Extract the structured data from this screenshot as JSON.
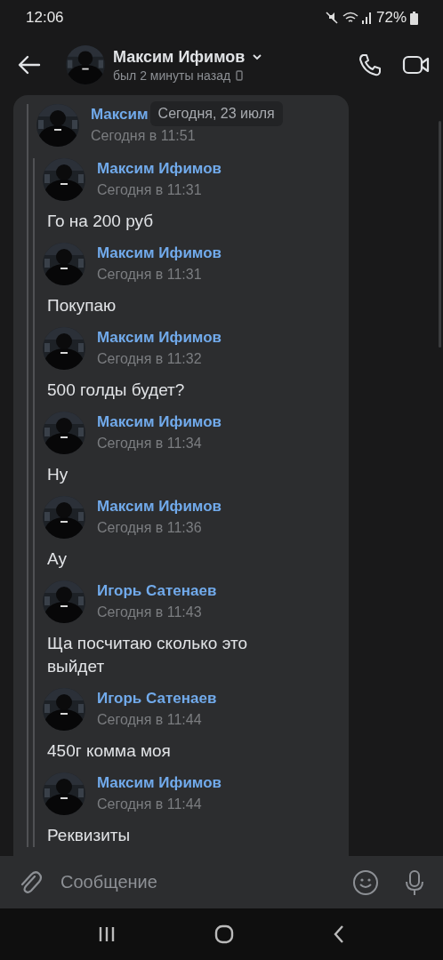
{
  "status_bar": {
    "time": "12:06",
    "battery": "72%"
  },
  "header": {
    "name": "Максим Ифимов",
    "status": "был 2 минуты назад"
  },
  "date_pill": "Сегодня, 23 июля",
  "forwarded": {
    "author": "Максим",
    "time": "Сегодня в 11:51",
    "messages": [
      {
        "author": "Максим Ифимов",
        "time": "Сегодня в 11:31",
        "text": "Го на 200 руб"
      },
      {
        "author": "Максим Ифимов",
        "time": "Сегодня в 11:31",
        "text": "Покупаю"
      },
      {
        "author": "Максим Ифимов",
        "time": "Сегодня в 11:32",
        "text": "500 голды будет?"
      },
      {
        "author": "Максим Ифимов",
        "time": "Сегодня в 11:34",
        "text": "Ну"
      },
      {
        "author": "Максим Ифимов",
        "time": "Сегодня в 11:36",
        "text": "Ау"
      },
      {
        "author": "Игорь Сатенаев",
        "time": "Сегодня в 11:43",
        "text": "Ща посчитаю сколько это выйдет"
      },
      {
        "author": "Игорь Сатенаев",
        "time": "Сегодня в 11:44",
        "text": "450г комма моя"
      },
      {
        "author": "Максим Ифимов",
        "time": "Сегодня в 11:44",
        "text": "Реквизиты"
      }
    ]
  },
  "composer": {
    "placeholder": "Сообщение"
  }
}
